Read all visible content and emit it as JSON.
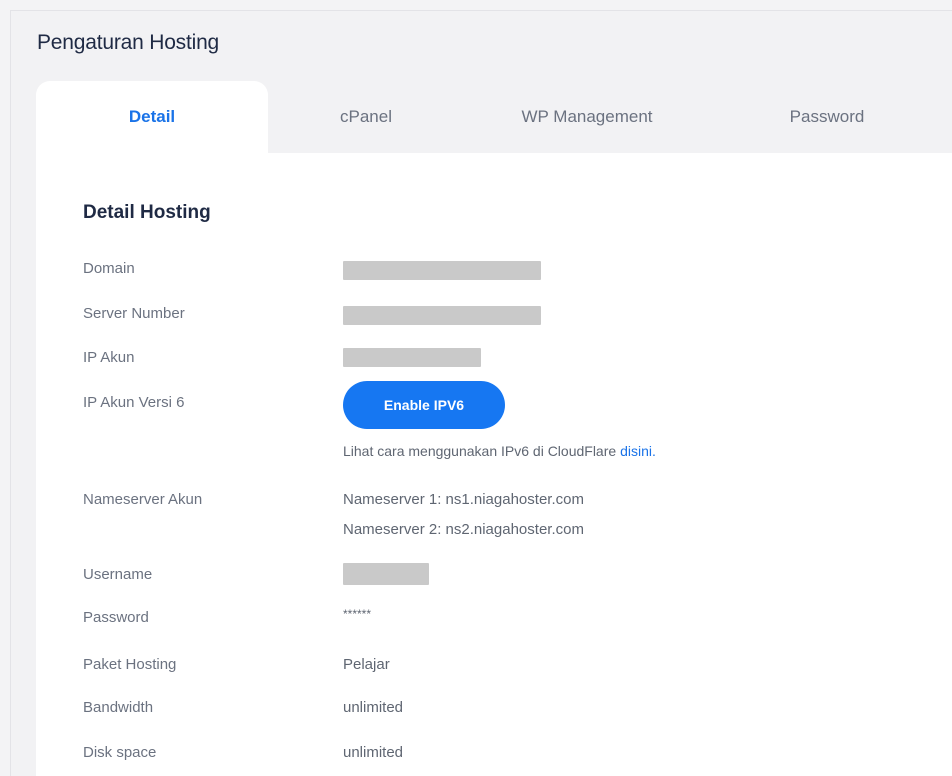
{
  "header": {
    "title": "Pengaturan Hosting"
  },
  "tabs": [
    {
      "label": "Detail",
      "active": true
    },
    {
      "label": "cPanel",
      "active": false
    },
    {
      "label": "WP Management",
      "active": false
    },
    {
      "label": "Password",
      "active": false
    }
  ],
  "detail": {
    "section_title": "Detail Hosting",
    "domain_label": "Domain",
    "server_number_label": "Server Number",
    "ip_akun_label": "IP Akun",
    "ipv6_label": "IP Akun Versi 6",
    "enable_ipv6_button": "Enable IPV6",
    "ipv6_note": "Lihat cara menggunakan IPv6 di CloudFlare",
    "ipv6_link": "disini.",
    "nameserver_label": "Nameserver Akun",
    "nameserver_1": "Nameserver 1: ns1.niagahoster.com",
    "nameserver_2": "Nameserver 2: ns2.niagahoster.com",
    "username_label": "Username",
    "password_label": "Password",
    "password_value": "******",
    "paket_label": "Paket Hosting",
    "paket_value": "Pelajar",
    "bandwidth_label": "Bandwidth",
    "bandwidth_value": "unlimited",
    "disk_label": "Disk space",
    "disk_value": "unlimited"
  },
  "colors": {
    "accent": "#1677f2",
    "link": "#1a73e8",
    "title": "#1f2a44",
    "muted": "#6b7280",
    "redacted": "#c9c9c9"
  }
}
